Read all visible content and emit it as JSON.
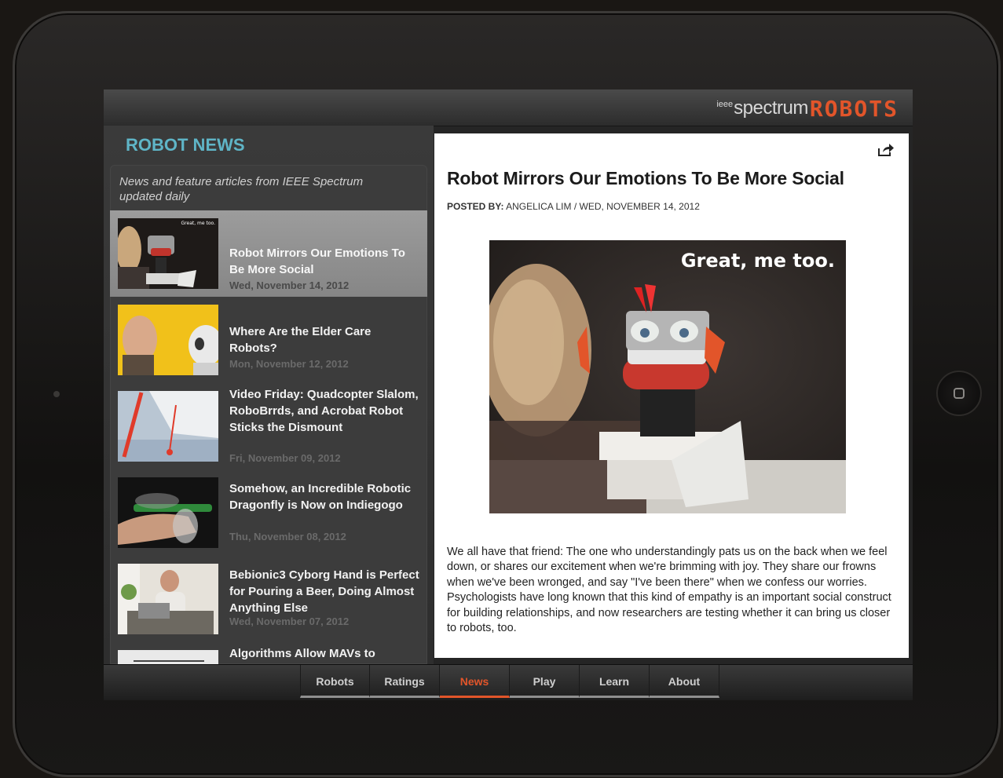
{
  "header": {
    "brand_ieee": "ieee",
    "brand_spectrum": "spectrum",
    "brand_robots": "ROBOTS"
  },
  "sidebar": {
    "title": "ROBOT NEWS",
    "intro": "News and feature articles from IEEE Spectrum updated daily",
    "items": [
      {
        "title": "Robot Mirrors Our Emotions To Be More Social",
        "date": "Wed, November 14, 2012",
        "selected": true
      },
      {
        "title": "Where Are the Elder Care Robots?",
        "date": "Mon, November 12, 2012"
      },
      {
        "title": "Video Friday: Quadcopter Slalom, RoboBrrds, and Acrobat Robot Sticks the Dismount",
        "date": "Fri, November 09, 2012"
      },
      {
        "title": "Somehow, an Incredible Robotic Dragonfly is Now on Indiegogo",
        "date": "Thu, November 08, 2012"
      },
      {
        "title": "Bebionic3 Cyborg Hand is Perfect for Pouring a Beer, Doing Almost Anything Else",
        "date": "Wed, November 07, 2012"
      },
      {
        "title": "Algorithms Allow MAVs to",
        "date": ""
      }
    ],
    "thumb_caption": "Great, me too."
  },
  "article": {
    "title": "Robot Mirrors Our Emotions To Be More Social",
    "posted_by_label": "POSTED BY:",
    "posted_by_meta": "ANGELICA LIM  /  WED, NOVEMBER 14, 2012",
    "image_caption": "Great, me too.",
    "body": "We all have that friend: The one who understandingly pats us on the back when we feel down, or shares our excitement when we're brimming with joy. They share our frowns when we've been wronged, and say \"I've been there\" when we confess our worries. Psychologists have long known that this kind of empathy is an important social construct for building relationships, and now researchers are testing whether it can bring us closer to robots, too."
  },
  "tabs": [
    {
      "label": "Robots"
    },
    {
      "label": "Ratings"
    },
    {
      "label": "News",
      "active": true
    },
    {
      "label": "Play"
    },
    {
      "label": "Learn"
    },
    {
      "label": "About"
    }
  ],
  "icons": {
    "share": "share-icon",
    "home": "home-button-icon"
  },
  "colors": {
    "accent": "#e2552a",
    "section_title": "#5fb5c7"
  }
}
